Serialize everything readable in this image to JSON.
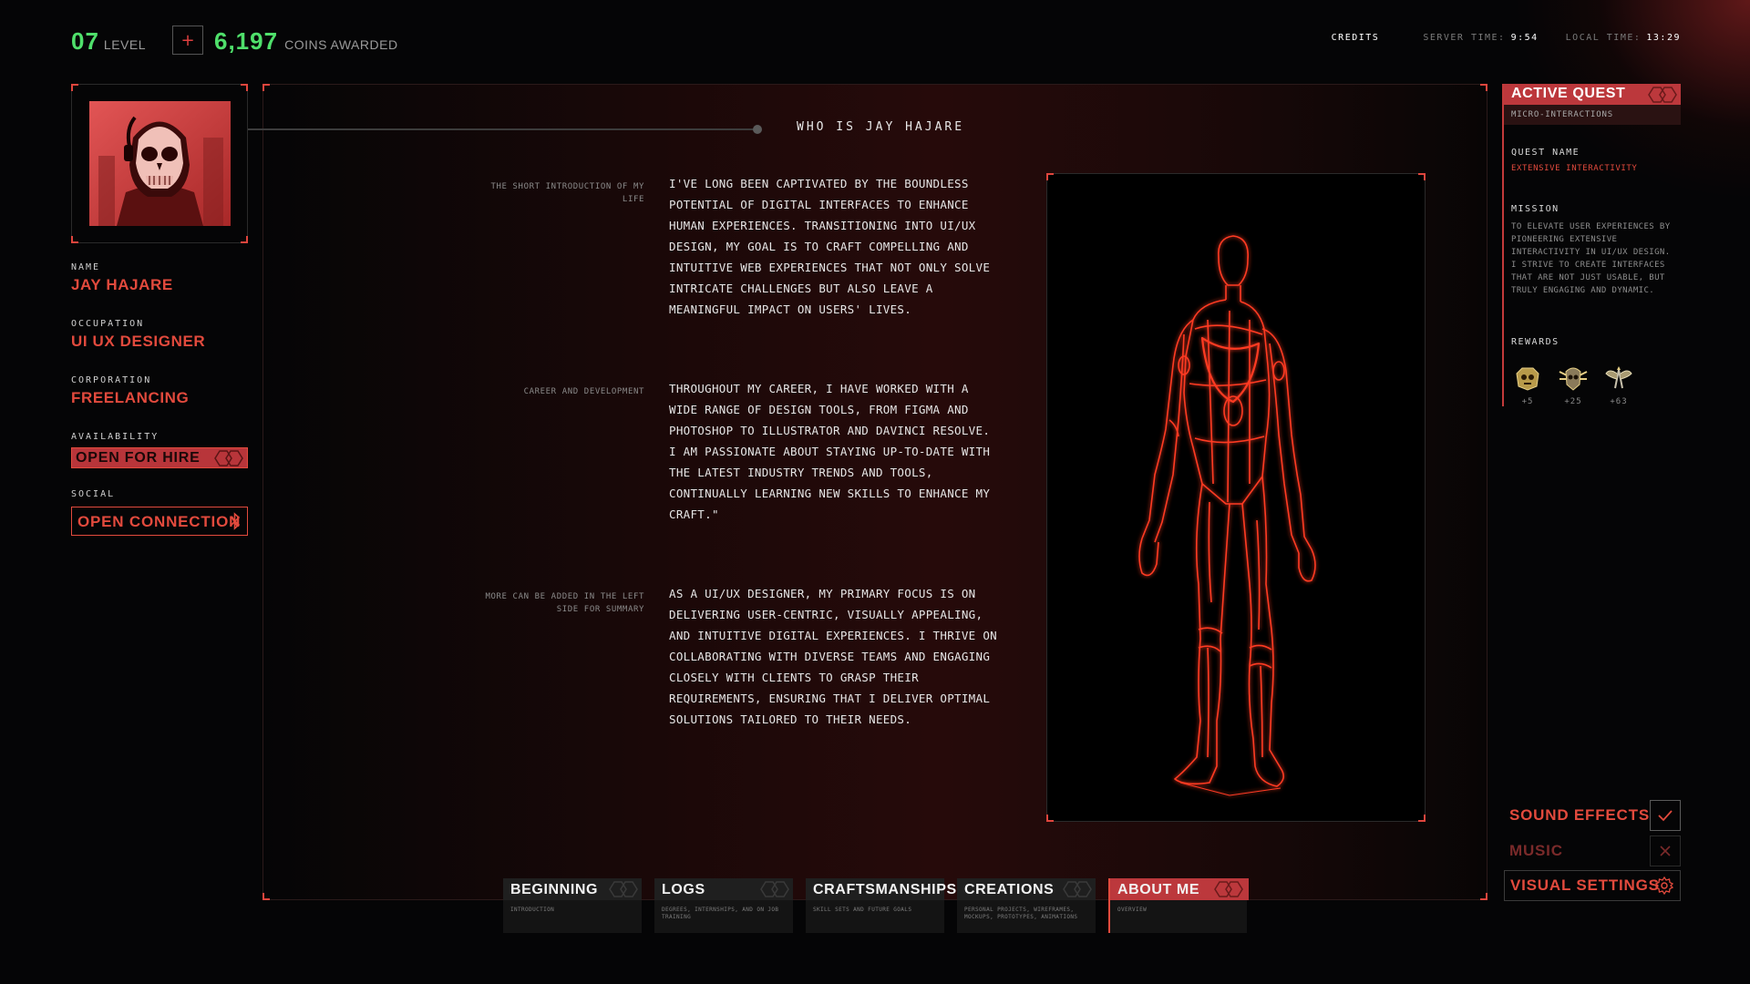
{
  "status": {
    "level_value": "07",
    "level_label": "LEVEL",
    "plus_label": "+",
    "coins_value": "6,197",
    "coins_label": "COINS AWARDED",
    "credits_label": "CREDITS",
    "server_time_label": "SERVER TIME:",
    "server_time_value": "9:54",
    "local_time_label": "LOCAL TIME:",
    "local_time_value": "13:29"
  },
  "profile": {
    "name_label": "NAME",
    "name_value": "JAY HAJARE",
    "occupation_label": "OCCUPATION",
    "occupation_value": "UI UX DESIGNER",
    "corporation_label": "CORPORATION",
    "corporation_value": "FREELANCING",
    "availability_label": "AVAILABILITY",
    "availability_value": "OPEN FOR HIRE",
    "social_label": "SOCIAL",
    "social_button": "OPEN CONNECTION"
  },
  "about": {
    "title": "WHO IS JAY HAJARE",
    "sections": [
      {
        "label": "THE SHORT INTRODUCTION OF MY LIFE",
        "text": "I'VE LONG BEEN CAPTIVATED BY THE BOUNDLESS POTENTIAL OF DIGITAL INTERFACES TO ENHANCE HUMAN EXPERIENCES. TRANSITIONING INTO UI/UX DESIGN, MY GOAL IS TO CRAFT COMPELLING AND INTUITIVE WEB EXPERIENCES THAT NOT ONLY SOLVE INTRICATE CHALLENGES BUT ALSO LEAVE A MEANINGFUL IMPACT ON USERS' LIVES."
      },
      {
        "label": "CAREER AND DEVELOPMENT",
        "text": "THROUGHOUT MY CAREER, I HAVE WORKED WITH A WIDE RANGE OF DESIGN TOOLS, FROM FIGMA AND PHOTOSHOP TO ILLUSTRATOR AND DAVINCI RESOLVE. I AM PASSIONATE ABOUT STAYING UP-TO-DATE WITH THE LATEST INDUSTRY TRENDS AND TOOLS, CONTINUALLY LEARNING NEW SKILLS TO ENHANCE MY CRAFT.\""
      },
      {
        "label": "MORE CAN BE ADDED IN THE LEFT SIDE FOR SUMMARY",
        "text": "AS A UI/UX DESIGNER, MY PRIMARY FOCUS IS ON DELIVERING USER-CENTRIC, VISUALLY APPEALING, AND INTUITIVE DIGITAL EXPERIENCES. I THRIVE ON COLLABORATING WITH DIVERSE TEAMS AND ENGAGING CLOSELY WITH CLIENTS TO GRASP THEIR REQUIREMENTS, ENSURING THAT I DELIVER OPTIMAL SOLUTIONS TAILORED TO THEIR NEEDS."
      }
    ]
  },
  "quest": {
    "header": "ACTIVE QUEST",
    "subheader": "MICRO-INTERACTIONS",
    "quest_name_label": "QUEST NAME",
    "quest_name_value": "EXTENSIVE INTERACTIVITY",
    "mission_label": "MISSION",
    "mission_text": "TO ELEVATE USER EXPERIENCES BY PIONEERING EXTENSIVE INTERACTIVITY IN UI/UX DESIGN. I STRIVE TO CREATE INTERFACES THAT ARE NOT JUST USABLE, BUT TRULY ENGAGING AND DYNAMIC.",
    "rewards_label": "REWARDS",
    "rewards": [
      {
        "icon": "skull-badge-icon",
        "value": "+5"
      },
      {
        "icon": "winged-skull-badge-icon",
        "value": "+25"
      },
      {
        "icon": "wings-badge-icon",
        "value": "+63"
      }
    ]
  },
  "settings": [
    {
      "label": "SOUND EFFECTS",
      "state": "on",
      "icon": "check-icon"
    },
    {
      "label": "MUSIC",
      "state": "off",
      "icon": "close-icon"
    },
    {
      "label": "VISUAL SETTINGS",
      "state": "open",
      "icon": "gear-icon"
    }
  ],
  "tabs": [
    {
      "title": "BEGINNING",
      "desc": "INTRODUCTION",
      "active": false
    },
    {
      "title": "LOGS",
      "desc": "DEGREES, INTERNSHIPS, AND ON JOB TRAINING",
      "active": false
    },
    {
      "title": "CRAFTSMANSHIPS",
      "desc": "SKILL SETS AND FUTURE GOALS",
      "active": false
    },
    {
      "title": "CREATIONS",
      "desc": "PERSONAL PROJECTS, WIREFRAMES, MOCKUPS, PROTOTYPES, ANIMATIONS",
      "active": false
    },
    {
      "title": "ABOUT ME",
      "desc": "OVERVIEW",
      "active": true
    }
  ],
  "colors": {
    "accent_red": "#e24a3d",
    "header_red": "#bc383c",
    "level_green": "#4fe06b",
    "background": "#050506"
  }
}
